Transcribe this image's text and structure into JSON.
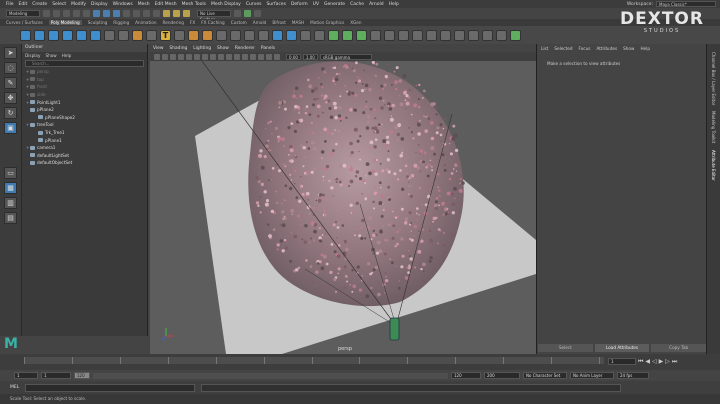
{
  "menubar": {
    "items": [
      "File",
      "Edit",
      "Create",
      "Select",
      "Modify",
      "Display",
      "Windows",
      "Mesh",
      "Edit Mesh",
      "Mesh Tools",
      "Mesh Display",
      "Curves",
      "Surfaces",
      "Deform",
      "UV",
      "Generate",
      "Cache",
      "Arnold",
      "Help"
    ],
    "workspace_label": "Workspace:",
    "workspace_value": "Maya Classic*"
  },
  "toolbar": {
    "mode": "Modeling",
    "live_surface": "No Live Surface"
  },
  "shelf_tabs": [
    "Curves / Surfaces",
    "Poly Modeling",
    "Sculpting",
    "Rigging",
    "Animation",
    "Rendering",
    "FX",
    "FX Caching",
    "Custom",
    "Arnold",
    "Bifrost",
    "MASH",
    "Motion Graphics",
    "XGen"
  ],
  "shelf_active": "Poly Modeling",
  "logo": {
    "line1": "DEXTOR",
    "line2": "STUDIOS"
  },
  "outliner": {
    "title": "Outliner",
    "menu": [
      "Display",
      "Show",
      "Help"
    ],
    "search_placeholder": "Search...",
    "items": [
      {
        "label": "persp",
        "dim": true,
        "open": true
      },
      {
        "label": "top",
        "dim": true,
        "open": true
      },
      {
        "label": "front",
        "dim": true,
        "open": true
      },
      {
        "label": "side",
        "dim": true,
        "open": true
      },
      {
        "label": "PointLight1",
        "dim": false,
        "open": true
      },
      {
        "label": "pPlane2",
        "dim": false,
        "open": false
      },
      {
        "label": "pPlaneShape2",
        "dim": false,
        "open": false
      },
      {
        "label": "treeTool",
        "dim": false,
        "open": true
      },
      {
        "label": "Trk_Tree1",
        "dim": false,
        "open": false
      },
      {
        "label": "pPlane1",
        "dim": false,
        "open": false
      },
      {
        "label": "camera1",
        "dim": false,
        "open": true
      },
      {
        "label": "defaultLightSet",
        "dim": false,
        "open": false
      },
      {
        "label": "defaultObjectSet",
        "dim": false,
        "open": false
      }
    ]
  },
  "viewport": {
    "menu": [
      "View",
      "Shading",
      "Lighting",
      "Show",
      "Renderer",
      "Panels"
    ],
    "field_a": "0.00",
    "field_b": "1.00",
    "color_space": "sRGB gamma",
    "camera_label": "persp"
  },
  "attribute_editor": {
    "menu": [
      "List",
      "Selected",
      "Focus",
      "Attributes",
      "Show",
      "Help"
    ],
    "message": "Make a selection to view attributes",
    "buttons": [
      "Select",
      "Load Attributes",
      "Copy Tab"
    ],
    "side_tabs": [
      "Channel Box / Layer Editor",
      "Modeling Toolkit",
      "Attribute Editor"
    ]
  },
  "timeline": {
    "ticks": [
      "1",
      "10",
      "20",
      "30",
      "40",
      "50",
      "60",
      "70",
      "80",
      "90",
      "100",
      "110",
      "120"
    ],
    "current_frame": "1"
  },
  "range": {
    "start": "1",
    "start2": "1",
    "range_val": "120",
    "end": "120",
    "end2": "200",
    "character_set": "No Character Set",
    "anim_layer": "No Anim Layer",
    "fps": "24 fps"
  },
  "cmdline": {
    "label": "MEL"
  },
  "status": {
    "text": "Scale Tool: Select an object to scale."
  }
}
